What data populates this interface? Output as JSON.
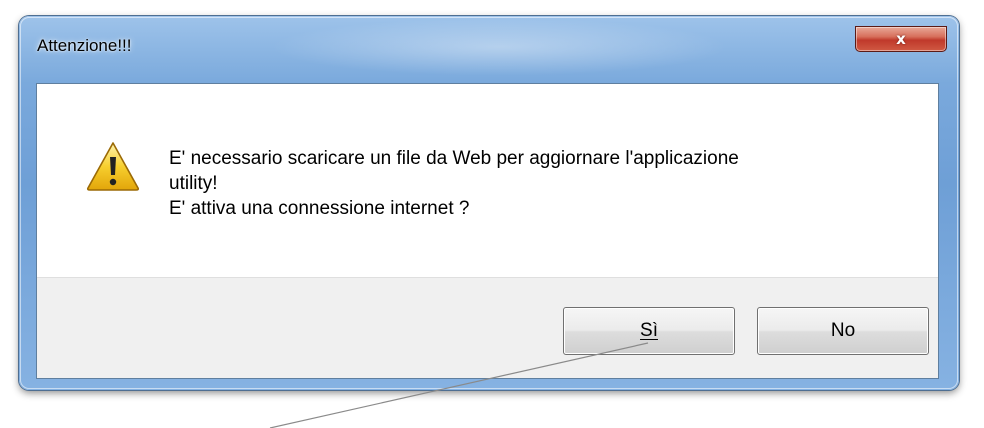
{
  "dialog": {
    "title": "Attenzione!!!",
    "close_label": "x",
    "icon": "warning-icon",
    "message_lines": [
      "E' necessario scaricare un file da Web per aggiornare l'applicazione",
      "utility!",
      "E' attiva una connessione internet ?"
    ],
    "buttons": {
      "yes_label": "Sì",
      "no_label": "No"
    }
  },
  "colors": {
    "frame": "#7aa9dc",
    "close_button": "#c0392b",
    "button_bar": "#f0f0f0",
    "warning_fill": "#f5c211"
  }
}
